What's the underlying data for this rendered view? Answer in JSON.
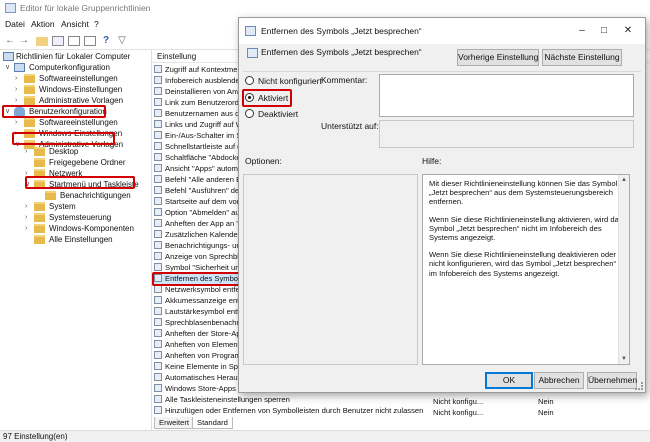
{
  "window": {
    "title": "Editor für lokale Gruppenrichtlinien"
  },
  "menu": [
    "Datei",
    "Aktion",
    "Ansicht",
    "?"
  ],
  "toolbar_icons": [
    "back-icon",
    "forward-icon",
    "folder-up-icon",
    "show-hide-tree-icon",
    "list-icon",
    "export-list-icon",
    "help-icon",
    "filter-icon"
  ],
  "tree": {
    "root": "Richtlinien für Lokaler Computer",
    "computer_config": "Computerkonfiguration",
    "cc_software": "Softwareeinstellungen",
    "cc_windows": "Windows-Einstellungen",
    "cc_admin": "Administrative Vorlagen",
    "user_config": "Benutzerkonfiguration",
    "uc_software": "Softwareeinstellungen",
    "uc_windows": "Windows-Einstellungen",
    "uc_admin": "Administrative Vorlagen",
    "desktop": "Desktop",
    "shared_folders": "Freigegebene Ordner",
    "network": "Netzwerk",
    "startmenu": "Startmenü und Taskleiste",
    "notifications": "Benachrichtigungen",
    "system": "System",
    "control_panel": "Systemsteuerung",
    "windows_components": "Windows-Komponenten",
    "all_settings": "Alle Einstellungen"
  },
  "list": {
    "header": "Einstellung",
    "rows": [
      "Zugriff auf Kontextmenü",
      "Infobereich ausblenden",
      "Deinstallieren von Anwe",
      "Link zum Benutzerordne",
      "Benutzernamen aus dem",
      "Links und Zugriff auf W",
      "Ein-/Aus-Schalter im Sta",
      "Schnellstartleiste auf de",
      "Schaltfläche \"Abdocken",
      "Ansicht \"Apps\" automat",
      "Befehl \"Alle anderen Benu",
      "Befehl \"Ausführen\" dem",
      "Startseite auf dem vom E",
      "Option \"Abmelden\" aus",
      "Anheften der App an \"St",
      "Zusätzlichen Kalender a",
      "Benachrichtigungs- und",
      "Anzeige von Sprechblas",
      "Symbol \"Sicherheit und",
      "Entfernen des Symbols",
      "Netzwerksymbol entfer",
      "Akkumessanzeige entfer",
      "Lautstärkesymbol entfer",
      "Sprechblasenbenachrich",
      "Anheften der Store-App",
      "Anheften von Elementen",
      "Anheften von Programm",
      "Keine Elemente in Sprun",
      "Automatisches Heraufst",
      "Windows Store-Apps au",
      "Alle Taskleisteneinstellungen sperren",
      "Hinzufügen oder Entfernen von Symbolleisten durch Benutzer nicht zulassen"
    ],
    "state_col": [
      "Nicht konfigu...",
      "Nicht konfigu..."
    ],
    "comment_col": [
      "Nein",
      "Nein"
    ]
  },
  "tabs": [
    "Erweitert",
    "Standard"
  ],
  "status": "97 Einstellung(en)",
  "dialog": {
    "title": "Entfernen des Symbols „Jetzt besprechen“",
    "heading": "Entfernen des Symbols „Jetzt besprechen“",
    "prev_btn": "Vorherige Einstellung",
    "next_btn": "Nächste Einstellung",
    "radio_not_configured": "Nicht konfiguriert",
    "radio_enabled": "Aktiviert",
    "radio_disabled": "Deaktiviert",
    "selected_state": "Aktiviert",
    "comment_label": "Kommentar:",
    "supported_label": "Unterstützt auf:",
    "options_label": "Optionen:",
    "help_label": "Hilfe:",
    "help_text": [
      "Mit dieser Richtlinieneinstellung können Sie das Symbol „Jetzt besprechen“ aus dem Systemsteuerungsbereich entfernen.",
      "Wenn Sie diese Richtlinieneinstellung aktivieren, wird das Symbol „Jetzt besprechen“ nicht im Infobereich des Systems angezeigt.",
      "Wenn Sie diese Richtlinieneinstellung deaktivieren oder nicht konfigurieren, wird das Symbol „Jetzt besprechen“ im Infobereich des Systems angezeigt."
    ],
    "ok": "OK",
    "cancel": "Abbrechen",
    "apply": "Übernehmen"
  },
  "colors": {
    "highlight": "#d20000",
    "selection": "#cde6fb",
    "accent": "#0078d7"
  }
}
